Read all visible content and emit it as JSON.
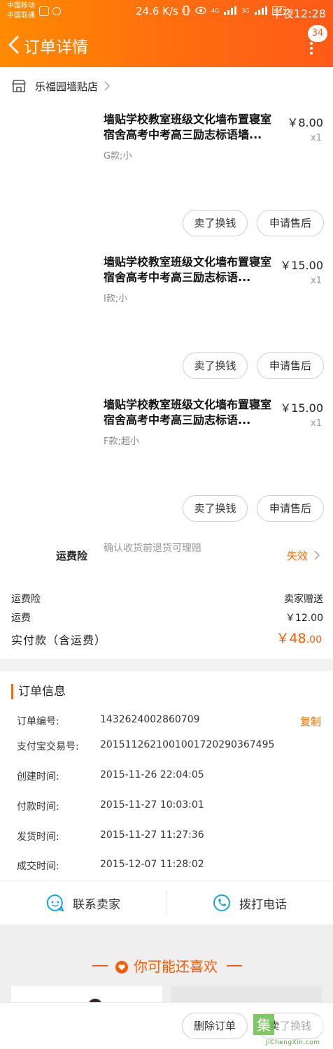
{
  "status_bar": {
    "carrier_1": "中国移动",
    "carrier_2": "中国联通",
    "speed": "24.6 K/s",
    "signal_1": "4G",
    "signal_2": "3G",
    "battery": "47",
    "time": "半夜12:28"
  },
  "header": {
    "title": "订单详情",
    "message_count": "34"
  },
  "shop": {
    "name": "乐福园墙贴店"
  },
  "items": [
    {
      "title": "墙贴学校教室班级文化墙布置寝室宿舍高考中考高三励志标语墙...",
      "price": "￥8.00",
      "qty": "x1",
      "spec": "G款;小",
      "sell_label": "卖了换钱",
      "after_sale_label": "申请售后"
    },
    {
      "title": "墙贴学校教室班级文化墙布置寝室宿舍高考中考高三励志标语...",
      "price": "￥15.00",
      "qty": "x1",
      "spec": "I款;小",
      "sell_label": "卖了换钱",
      "after_sale_label": "申请售后"
    },
    {
      "title": "墙贴学校教室班级文化墙布置寝室宿舍高考中考高三励志标语...",
      "price": "￥15.00",
      "qty": "x1",
      "spec": "F款;超小",
      "sell_label": "卖了换钱",
      "after_sale_label": "申请售后"
    }
  ],
  "insurance": {
    "label": "运费险",
    "description": "确认收货前退货可理赔",
    "status": "失效"
  },
  "fees": {
    "insurance_label": "运费险",
    "insurance_value": "卖家赠送",
    "shipping_label": "运费",
    "shipping_value": "￥12.00",
    "paid_label": "实付款（含运费）",
    "paid_int": "￥48",
    "paid_dec": ".00"
  },
  "order_info": {
    "title": "订单信息",
    "copy_label": "复制",
    "rows": [
      {
        "key": "订单编号:",
        "value": "1432624002860709"
      },
      {
        "key": "支付宝交易号:",
        "value": "2015112621001001720290367495"
      },
      {
        "key": "创建时间:",
        "value": "2015-11-26 22:04:05"
      },
      {
        "key": "付款时间:",
        "value": "2015-11-27 10:03:01"
      },
      {
        "key": "发货时间:",
        "value": "2015-11-27 11:27:36"
      },
      {
        "key": "成交时间:",
        "value": "2015-12-07 11:28:02"
      }
    ]
  },
  "contact": {
    "seller_label": "联系卖家",
    "call_label": "拨打电话"
  },
  "recommend": {
    "title": "你可能还喜欢"
  },
  "bottom": {
    "delete_label": "删除订单",
    "sell_label": "卖了换钱"
  },
  "watermark": {
    "text": "JiChengXin.com"
  },
  "colors": {
    "brand_orange": "#ff6a10",
    "price_orange": "#ff5a00"
  }
}
